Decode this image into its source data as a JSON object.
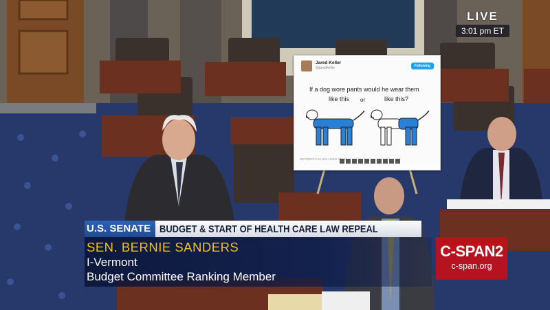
{
  "live_bug": {
    "label": "LIVE",
    "time": "3:01 pm ET"
  },
  "poster": {
    "account_name": "Jared Keller",
    "handle": "@jaredkeller",
    "follow_label": "Following",
    "question_line1": "If a dog wore pants would he wear them",
    "option_left": "like this",
    "option_or": "or",
    "option_right": "like this?",
    "stats": "RETWEETS 51,304   LIKES 37,184"
  },
  "lower_third": {
    "network": "U.S. SENATE",
    "topic": "BUDGET & START OF HEALTH CARE LAW REPEAL",
    "name": "SEN. BERNIE SANDERS",
    "affiliation": "I-Vermont",
    "role": "Budget Committee Ranking Member"
  },
  "network_bug": {
    "logo": "C-SPAN2",
    "url": "c-span.org"
  },
  "colors": {
    "lower_third_name": "#f3c01d",
    "network_bug": "#c30f19",
    "dog_pants": "#2a7fd6"
  }
}
